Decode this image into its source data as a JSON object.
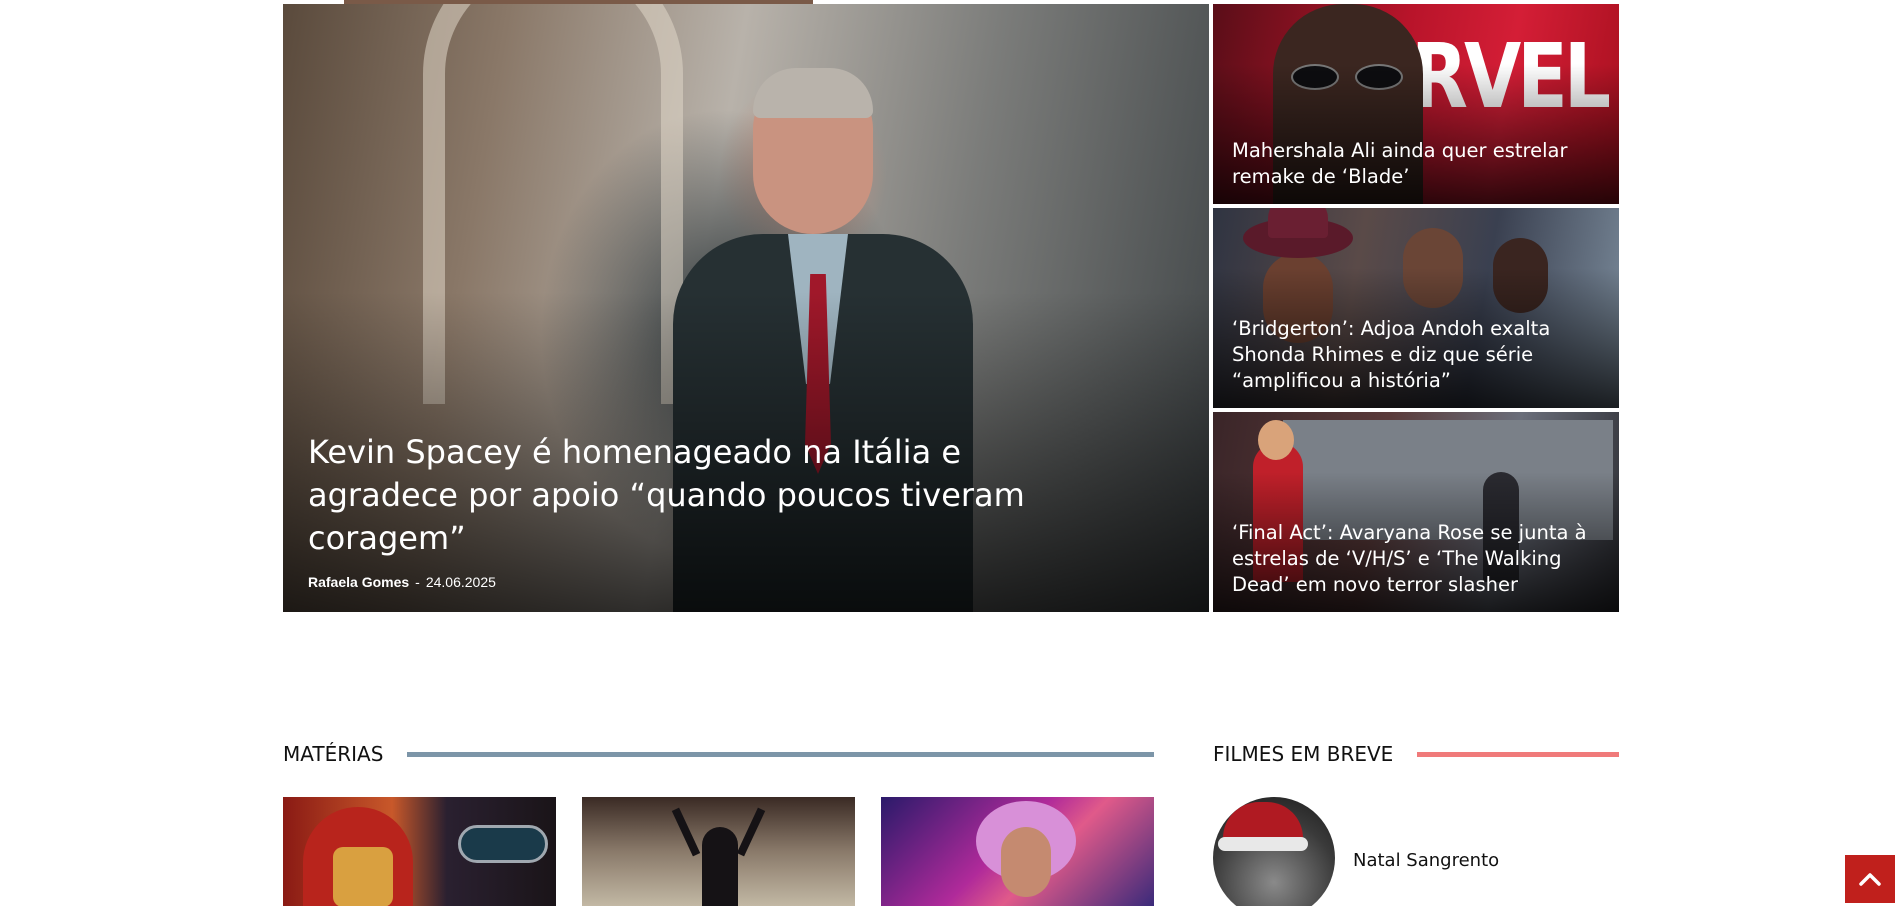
{
  "hero": {
    "title": "Kevin Spacey é homenageado na Itália e agradece por apoio “quando poucos tiveram coragem”",
    "author": "Rafaela Gomes",
    "separator": "-",
    "date": "24.06.2025"
  },
  "side_articles": [
    {
      "title": "Mahershala Ali ainda quer estrelar remake de ‘Blade’",
      "image_text": "MARVEL"
    },
    {
      "title": "‘Bridgerton’: Adjoa Andoh exalta Shonda Rhimes e diz que série “amplificou a história”"
    },
    {
      "title": "‘Final Act’: Avaryana Rose se junta à estrelas de ‘V/H/S’ e ‘The Walking Dead’ em novo terror slasher"
    }
  ],
  "sections": {
    "materias": {
      "label": "MATÉRIAS",
      "rule_color": "#7c95a8"
    },
    "filmes": {
      "label": "FILMES EM BREVE",
      "rule_color": "#f07a7a"
    }
  },
  "upcoming_films": [
    {
      "title": "Natal Sangrento"
    }
  ],
  "back_to_top": {
    "icon": "chevron-up-icon",
    "color": "#c0201c"
  }
}
